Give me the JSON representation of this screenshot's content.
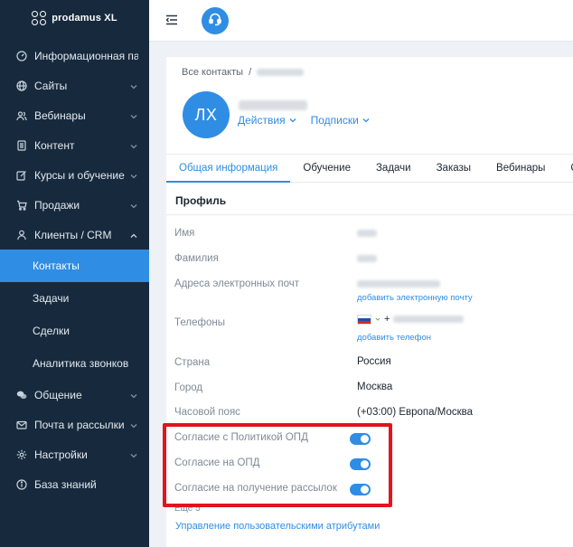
{
  "brand": {
    "name": "prodamus XL"
  },
  "sidebar": {
    "items": [
      {
        "label": "Информационная пан...",
        "icon": "dashboard-icon",
        "has_chevron": false
      },
      {
        "label": "Сайты",
        "icon": "globe-icon",
        "has_chevron": true
      },
      {
        "label": "Вебинары",
        "icon": "users-icon",
        "has_chevron": true
      },
      {
        "label": "Контент",
        "icon": "document-icon",
        "has_chevron": true
      },
      {
        "label": "Курсы и обучение",
        "icon": "edit-icon",
        "has_chevron": true
      },
      {
        "label": "Продажи",
        "icon": "cart-icon",
        "has_chevron": true
      },
      {
        "label": "Клиенты / CRM",
        "icon": "user-icon",
        "has_chevron": true,
        "open": true
      },
      {
        "label": "Общение",
        "icon": "chat-icon",
        "has_chevron": true
      },
      {
        "label": "Почта и рассылки",
        "icon": "mail-icon",
        "has_chevron": true
      },
      {
        "label": "Настройки",
        "icon": "gear-icon",
        "has_chevron": true
      },
      {
        "label": "База знаний",
        "icon": "info-icon",
        "has_chevron": false
      }
    ],
    "subitems": [
      {
        "label": "Контакты",
        "active": true
      },
      {
        "label": "Задачи"
      },
      {
        "label": "Сделки"
      },
      {
        "label": "Аналитика звонков"
      }
    ]
  },
  "topbar": {
    "menu_icon": "menu-collapse-icon",
    "support_icon": "headset-icon"
  },
  "contact": {
    "breadcrumb_root": "Все контакты",
    "breadcrumb_sep": "/",
    "avatar_initials": "ЛХ",
    "actions_label": "Действия",
    "subscriptions_label": "Подписки"
  },
  "tabs": [
    {
      "label": "Общая информация",
      "active": true
    },
    {
      "label": "Обучение"
    },
    {
      "label": "Задачи"
    },
    {
      "label": "Заказы"
    },
    {
      "label": "Вебинары"
    },
    {
      "label": "Сде"
    }
  ],
  "profile": {
    "section_title": "Профиль",
    "first_name_label": "Имя",
    "last_name_label": "Фамилия",
    "emails_label": "Адреса электронных почт",
    "add_email": "добавить электронную почту",
    "phones_label": "Телефоны",
    "phone_prefix": "+",
    "add_phone": "добавить телефон",
    "country_label": "Страна",
    "country_value": "Россия",
    "city_label": "Город",
    "city_value": "Москва",
    "timezone_label": "Часовой пояс",
    "timezone_value": "(+03:00) Европа/Москва",
    "consent_policy_label": "Согласие с Политикой ОПД",
    "consent_pd_label": "Согласие на ОПД",
    "consent_mailing_label": "Согласие на получение рассылок",
    "consents": {
      "policy": true,
      "pd": true,
      "mailing": true
    },
    "more_label": "Еще 5",
    "manage_attributes": "Управление пользовательскими атрибутами"
  },
  "colors": {
    "sidebar_bg": "#172a3d",
    "accent": "#2f8de4",
    "highlight": "#e2141c"
  }
}
